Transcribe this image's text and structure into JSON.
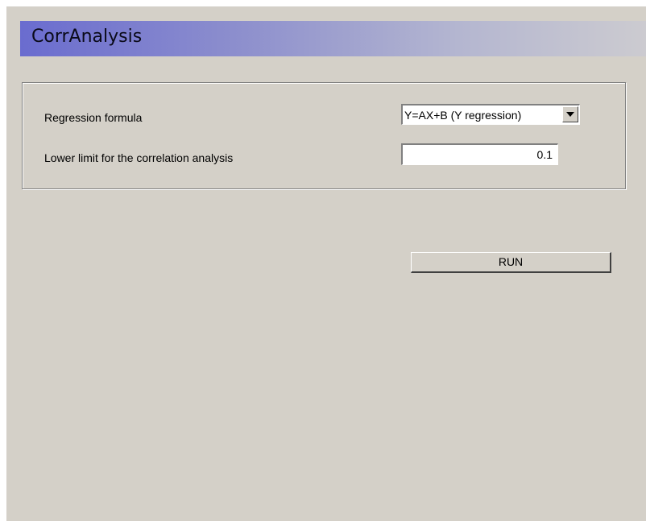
{
  "window": {
    "title": "CorrAnalysis"
  },
  "settings": {
    "regression_formula": {
      "label": "Regression formula",
      "selected_value": "Y=AX+B (Y regression)"
    },
    "lower_limit": {
      "label": "Lower limit for the correlation analysis",
      "value": "0.1"
    }
  },
  "actions": {
    "run_label": "RUN"
  },
  "colors": {
    "title_gradient_start": "#6a6ccf",
    "title_gradient_end": "#cccbd0",
    "panel_background": "#d4d0c8"
  },
  "icons": {
    "dropdown": "chevron-down-icon"
  }
}
